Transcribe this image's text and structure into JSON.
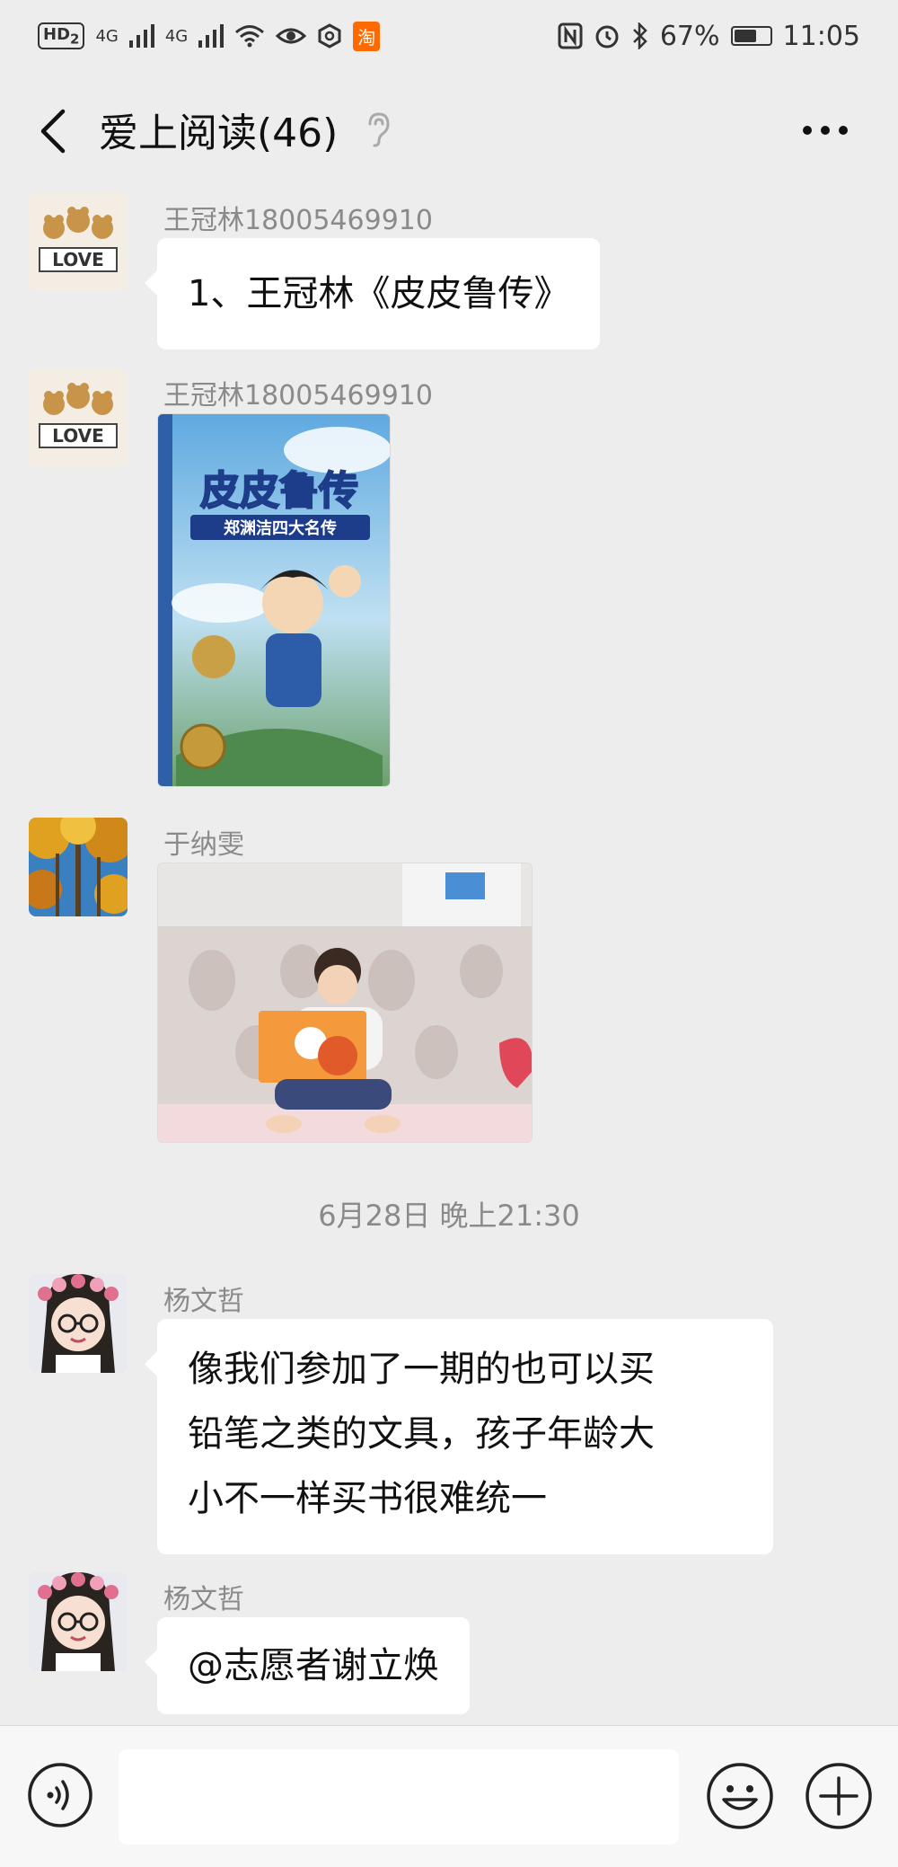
{
  "status_bar": {
    "left_chip": "HD",
    "left_chip_sub": "2",
    "network_1": "4G",
    "network_2": "4G",
    "app_badge": "淘",
    "battery_text": "67%",
    "battery_level": 0.67,
    "time": "11:05"
  },
  "header": {
    "title": "爱上阅读(46)"
  },
  "messages": [
    {
      "sender": "王冠林18005469910",
      "type": "text",
      "text": "1、王冠林《皮皮鲁传》"
    },
    {
      "sender": "王冠林18005469910",
      "type": "image",
      "book": {
        "title": "皮皮鲁传",
        "subtitle": "郑渊洁四大名传"
      }
    },
    {
      "sender": "于纳雯",
      "type": "image"
    },
    {
      "sender": "杨文哲",
      "type": "text",
      "lines": [
        "像我们参加了一期的也可以买",
        "铅笔之类的文具，孩子年龄大",
        "小不一样买书很难统一"
      ]
    },
    {
      "sender": "杨文哲",
      "type": "text",
      "text": "@志愿者谢立焕"
    }
  ],
  "timestamp": "6月28日 晚上21:30",
  "input_bar": {
    "placeholder": ""
  },
  "icons": {
    "back": "chevron-left-icon",
    "ear": "ear-icon",
    "more": "more-icon",
    "voice": "voice-icon",
    "emoji": "emoji-icon",
    "plus": "plus-icon"
  }
}
